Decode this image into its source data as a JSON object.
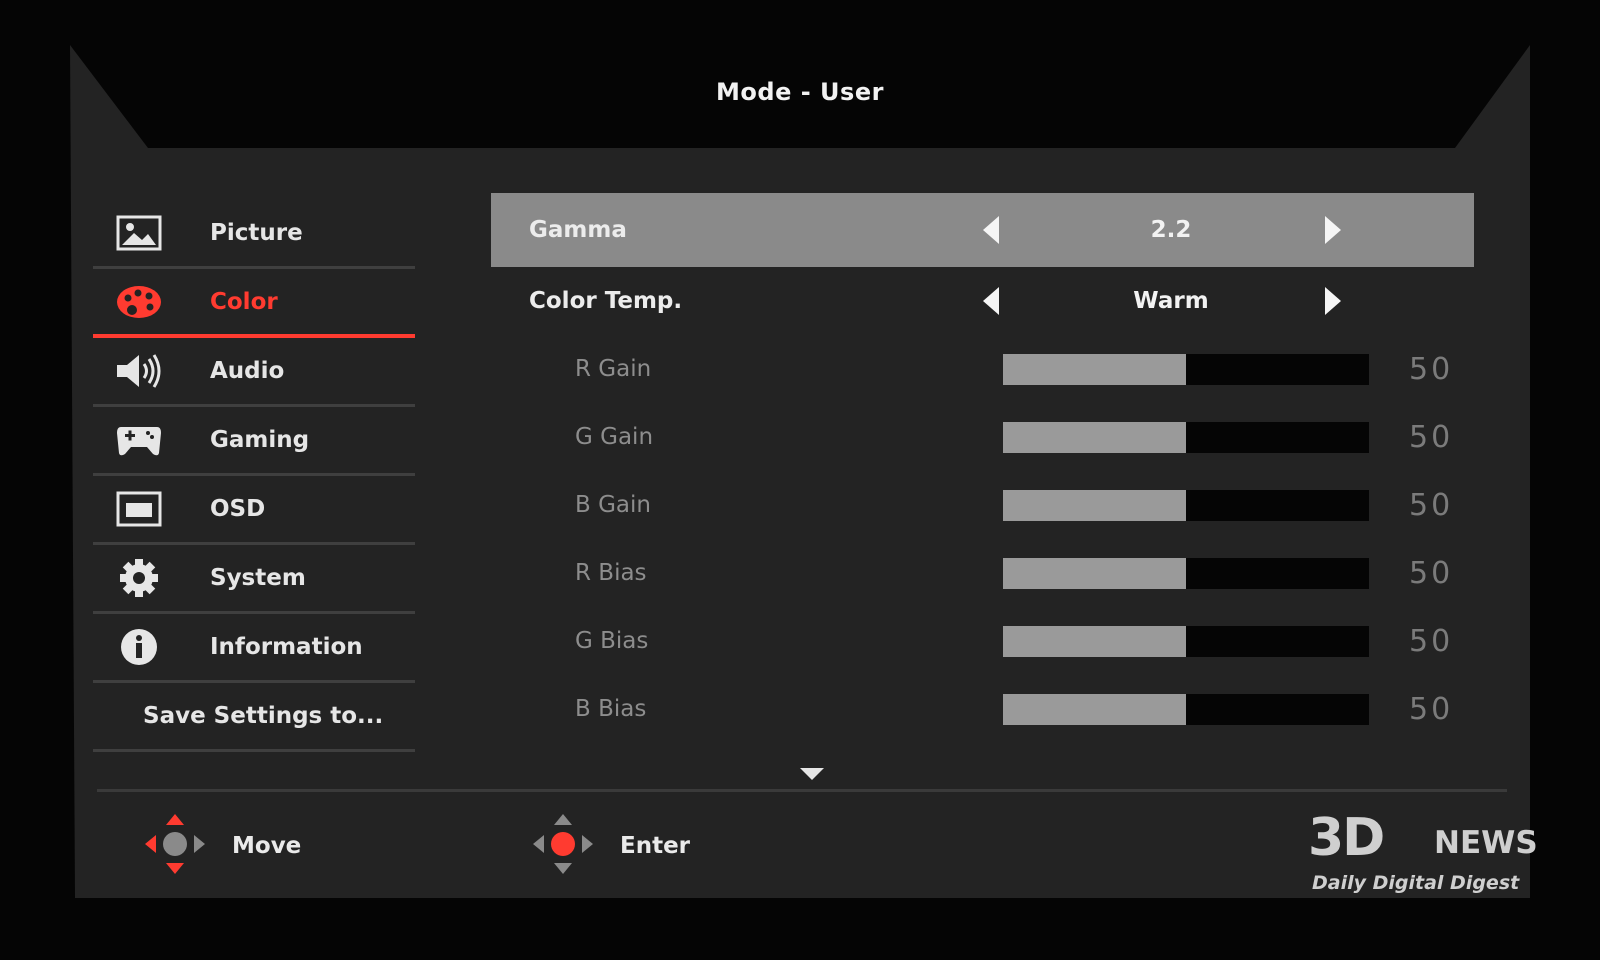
{
  "header": {
    "title": "Mode - User"
  },
  "colors": {
    "accent": "#ff3b30",
    "panel": "#232323",
    "selected_row": "#8a8a8a"
  },
  "menu": {
    "items": [
      {
        "label": "Picture",
        "icon": "picture-icon",
        "active": false
      },
      {
        "label": "Color",
        "icon": "palette-icon",
        "active": true
      },
      {
        "label": "Audio",
        "icon": "speaker-icon",
        "active": false
      },
      {
        "label": "Gaming",
        "icon": "gamepad-icon",
        "active": false
      },
      {
        "label": "OSD",
        "icon": "osd-window-icon",
        "active": false
      },
      {
        "label": "System",
        "icon": "gear-icon",
        "active": false
      },
      {
        "label": "Information",
        "icon": "info-icon",
        "active": false
      },
      {
        "label": "Save Settings to...",
        "icon": "",
        "active": false
      }
    ]
  },
  "settings": {
    "gamma": {
      "label": "Gamma",
      "value": "2.2"
    },
    "color_temp": {
      "label": "Color Temp.",
      "value": "Warm"
    },
    "sliders": [
      {
        "label": "R Gain",
        "value": "50",
        "fill": 0.5
      },
      {
        "label": "G Gain",
        "value": "50",
        "fill": 0.5
      },
      {
        "label": "B Gain",
        "value": "50",
        "fill": 0.5
      },
      {
        "label": "R Bias",
        "value": "50",
        "fill": 0.5
      },
      {
        "label": "G Bias",
        "value": "50",
        "fill": 0.5
      },
      {
        "label": "B Bias",
        "value": "50",
        "fill": 0.5
      }
    ]
  },
  "footer": {
    "move": {
      "label": "Move",
      "icon": "dpad-move-icon"
    },
    "enter": {
      "label": "Enter",
      "icon": "dpad-enter-icon"
    }
  },
  "watermark": {
    "logo": "3D",
    "news": "NEWS",
    "tagline": "Daily Digital Digest"
  }
}
